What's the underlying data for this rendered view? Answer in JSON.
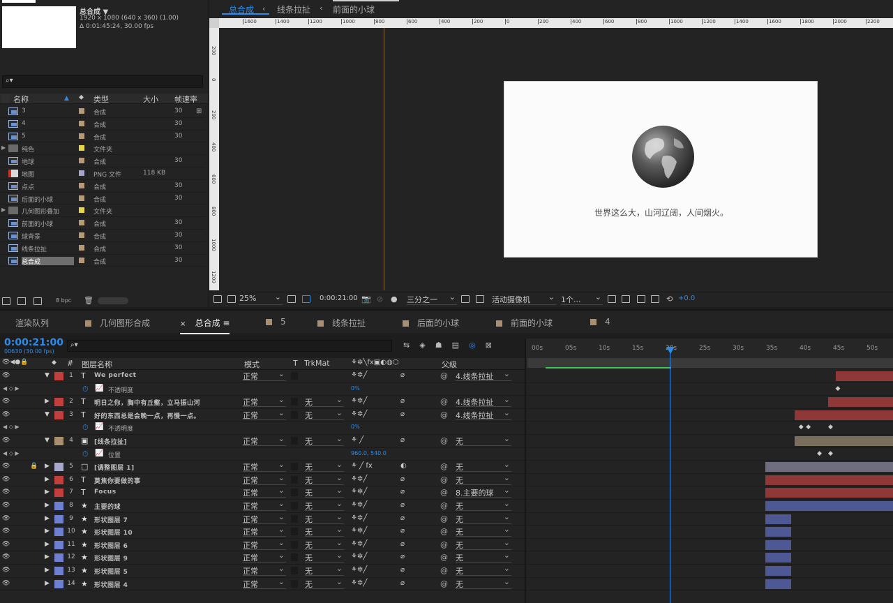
{
  "project": {
    "comp_name": "总合成 ▼",
    "comp_res": "1920 x 1080  (640 x 360) (1.00)",
    "comp_dur": "Δ 0:01:45:24, 30.00 fps",
    "search_icon": "⌕▾",
    "columns": {
      "name": "名称",
      "type": "类型",
      "size": "大小",
      "fps": "帧速率"
    },
    "items": [
      {
        "name": "3",
        "icon": "comp",
        "color": "#b59a78",
        "type": "合成",
        "size": "",
        "fps": "30"
      },
      {
        "name": "4",
        "icon": "comp",
        "color": "#b59a78",
        "type": "合成",
        "size": "",
        "fps": "30"
      },
      {
        "name": "5",
        "icon": "comp",
        "color": "#b59a78",
        "type": "合成",
        "size": "",
        "fps": "30"
      },
      {
        "name": "纯色",
        "icon": "folder",
        "color": "#e4d54a",
        "type": "文件夹",
        "size": "",
        "fps": ""
      },
      {
        "name": "地球",
        "icon": "comp",
        "color": "#b59a78",
        "type": "合成",
        "size": "",
        "fps": "30"
      },
      {
        "name": "地图",
        "icon": "png",
        "color": "#a6a6c8",
        "type": "PNG 文件",
        "size": "118 KB",
        "fps": ""
      },
      {
        "name": "点点",
        "icon": "comp",
        "color": "#b59a78",
        "type": "合成",
        "size": "",
        "fps": "30"
      },
      {
        "name": "后面的小球",
        "icon": "comp",
        "color": "#b59a78",
        "type": "合成",
        "size": "",
        "fps": "30"
      },
      {
        "name": "几何图形叠加",
        "icon": "folder",
        "color": "#e4d54a",
        "type": "文件夹",
        "size": "",
        "fps": ""
      },
      {
        "name": "前面的小球",
        "icon": "comp",
        "color": "#b59a78",
        "type": "合成",
        "size": "",
        "fps": "30"
      },
      {
        "name": "球背景",
        "icon": "comp",
        "color": "#b59a78",
        "type": "合成",
        "size": "",
        "fps": "30"
      },
      {
        "name": "线条拉扯",
        "icon": "comp",
        "color": "#b59a78",
        "type": "合成",
        "size": "",
        "fps": "30"
      },
      {
        "name": "总合成",
        "icon": "comp",
        "color": "#b59a78",
        "type": "合成",
        "size": "",
        "fps": "30",
        "selected": true
      }
    ],
    "bpc": "8 bpc"
  },
  "viewer": {
    "tabs": [
      "总合成",
      "线条拉扯",
      "前面的小球"
    ],
    "ruler_h": [
      "1600",
      "1400",
      "1200",
      "1000",
      "800",
      "600",
      "400",
      "200",
      "0",
      "200",
      "400",
      "600",
      "800",
      "1000",
      "1200",
      "1400",
      "1600",
      "1800",
      "2000",
      "2200"
    ],
    "ruler_v": [
      "200",
      "0",
      "200",
      "400",
      "600",
      "800",
      "1000",
      "1200"
    ],
    "comp_caption": "世界这么大，山河辽阔，人间烟火。",
    "zoom": "25%",
    "time": "0:00:21:00",
    "resolution": "三分之一",
    "camera": "活动摄像机",
    "views": "1个...",
    "exposure": "+0.0"
  },
  "timeline": {
    "tabs": [
      {
        "label": "渲染队列",
        "swatch": false
      },
      {
        "label": "几何图形合成",
        "swatch": true
      },
      {
        "label": "总合成",
        "swatch": false,
        "active": true
      },
      {
        "label": "5",
        "swatch": true
      },
      {
        "label": "线条拉扯",
        "swatch": true
      },
      {
        "label": "后面的小球",
        "swatch": true
      },
      {
        "label": "前面的小球",
        "swatch": true
      },
      {
        "label": "4",
        "swatch": true
      }
    ],
    "timecode": "0:00:21:00",
    "frames": "00630 (30.00 fps)",
    "headers": {
      "num": "#",
      "name": "图层名称",
      "mode": "模式",
      "t": "T",
      "trkmat": "TrkMat",
      "parent": "父级"
    },
    "ticks": [
      "00s",
      "05s",
      "10s",
      "15s",
      "20s",
      "25s",
      "30s",
      "35s",
      "40s",
      "45s",
      "50s"
    ],
    "rows": [
      {
        "kind": "layer",
        "num": "1",
        "color": "#c1403d",
        "icon": "T",
        "name": "We perfect",
        "mode": "正常",
        "trk": "",
        "parent": "4.线条拉扯",
        "expanded": true,
        "bar": {
          "start": 0.84,
          "end": 1.0,
          "color": "#8f3838"
        }
      },
      {
        "kind": "prop",
        "name": "不透明度",
        "value": "0%",
        "keys": [
          0.84
        ]
      },
      {
        "kind": "layer",
        "num": "2",
        "color": "#c1403d",
        "icon": "T",
        "name": "明日之你，胸中有丘壑，立马振山河",
        "mode": "正常",
        "trk": "无",
        "parent": "4.线条拉扯",
        "bar": {
          "start": 0.82,
          "end": 1.0,
          "color": "#8f3838"
        }
      },
      {
        "kind": "layer",
        "num": "3",
        "color": "#c1403d",
        "icon": "T",
        "name": "好的东西总是会晚一点，再慢一点。",
        "mode": "正常",
        "trk": "无",
        "parent": "4.线条拉扯",
        "expanded": true,
        "bar": {
          "start": 0.73,
          "end": 1.0,
          "color": "#8f3838"
        }
      },
      {
        "kind": "prop",
        "name": "不透明度",
        "value": "0%",
        "keys": [
          0.74,
          0.76,
          0.82
        ]
      },
      {
        "kind": "layer",
        "num": "4",
        "color": "#a98f6d",
        "icon": "▣",
        "name": "[线条拉扯]",
        "mode": "正常",
        "trk": "无",
        "parent": "无",
        "expanded": true,
        "bar": {
          "start": 0.73,
          "end": 1.0,
          "color": "#7a6e5c"
        }
      },
      {
        "kind": "prop",
        "name": "位置",
        "value": "960.0, 540.0",
        "keys": [
          0.79,
          0.82
        ]
      },
      {
        "kind": "layer",
        "num": "5",
        "color": "#a8a8cf",
        "icon": "□",
        "name": "[调整图层 1]",
        "mode": "正常",
        "trk": "无",
        "parent": "无",
        "locked": true,
        "bar": {
          "start": 0.65,
          "end": 1.0,
          "color": "#6e6e80"
        }
      },
      {
        "kind": "layer",
        "num": "6",
        "color": "#c1403d",
        "icon": "T",
        "name": "莫焦你要做的事",
        "mode": "正常",
        "trk": "无",
        "parent": "无",
        "bar": {
          "start": 0.65,
          "end": 1.0,
          "color": "#8f3838"
        }
      },
      {
        "kind": "layer",
        "num": "7",
        "color": "#c1403d",
        "icon": "T",
        "name": "Focus",
        "mode": "正常",
        "trk": "无",
        "parent": "8.主要的球",
        "bar": {
          "start": 0.65,
          "end": 1.0,
          "color": "#8f3838"
        }
      },
      {
        "kind": "layer",
        "num": "8",
        "color": "#6f7fd1",
        "icon": "★",
        "name": "主要的球",
        "mode": "正常",
        "trk": "无",
        "parent": "无",
        "bar": {
          "start": 0.65,
          "end": 1.0,
          "color": "#4d5895"
        }
      },
      {
        "kind": "layer",
        "num": "9",
        "color": "#6f7fd1",
        "icon": "★",
        "name": "形状图层 7",
        "mode": "正常",
        "trk": "无",
        "parent": "无",
        "bar": {
          "start": 0.65,
          "end": 0.72,
          "color": "#4d5895"
        }
      },
      {
        "kind": "layer",
        "num": "10",
        "color": "#6f7fd1",
        "icon": "★",
        "name": "形状图层 10",
        "mode": "正常",
        "trk": "无",
        "parent": "无",
        "bar": {
          "start": 0.65,
          "end": 0.72,
          "color": "#4d5895"
        }
      },
      {
        "kind": "layer",
        "num": "11",
        "color": "#6f7fd1",
        "icon": "★",
        "name": "形状图层 6",
        "mode": "正常",
        "trk": "无",
        "parent": "无",
        "bar": {
          "start": 0.65,
          "end": 0.72,
          "color": "#4d5895"
        }
      },
      {
        "kind": "layer",
        "num": "12",
        "color": "#6f7fd1",
        "icon": "★",
        "name": "形状图层 9",
        "mode": "正常",
        "trk": "无",
        "parent": "无",
        "bar": {
          "start": 0.65,
          "end": 0.72,
          "color": "#4d5895"
        }
      },
      {
        "kind": "layer",
        "num": "13",
        "color": "#6f7fd1",
        "icon": "★",
        "name": "形状图层 5",
        "mode": "正常",
        "trk": "无",
        "parent": "无",
        "bar": {
          "start": 0.65,
          "end": 0.72,
          "color": "#4d5895"
        }
      },
      {
        "kind": "layer",
        "num": "14",
        "color": "#6f7fd1",
        "icon": "★",
        "name": "形状图层 4",
        "mode": "正常",
        "trk": "无",
        "parent": "无",
        "bar": {
          "start": 0.65,
          "end": 0.72,
          "color": "#4d5895"
        }
      }
    ]
  },
  "icons": {
    "eye": "eye-icon",
    "lock": "lock-icon",
    "stopwatch": "stopwatch-icon",
    "keyframe": "keyframe-icon"
  },
  "colors": {
    "accent": "#2d8ceb",
    "cache": "#3ec95a",
    "guide": "#8b6b3f"
  }
}
